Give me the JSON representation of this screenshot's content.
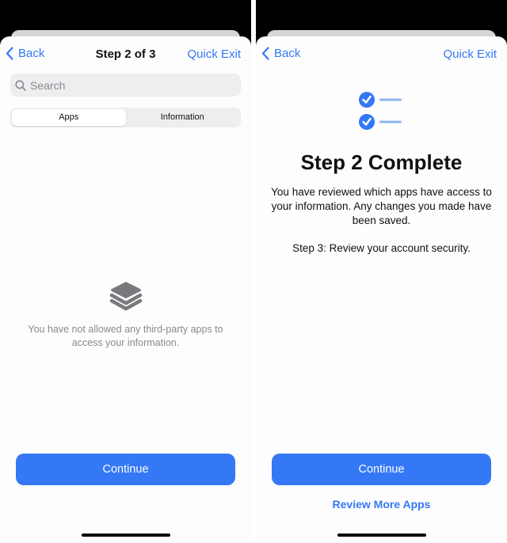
{
  "left_screen": {
    "nav": {
      "back_label": "Back",
      "title": "Step 2 of 3",
      "quick_exit_label": "Quick Exit"
    },
    "search": {
      "placeholder": "Search",
      "value": ""
    },
    "segments": [
      {
        "label": "Apps",
        "selected": true
      },
      {
        "label": "Information",
        "selected": false
      }
    ],
    "empty_state": {
      "icon": "stack-layers-icon",
      "message": "You have not allowed any third-party apps to access your information."
    },
    "continue_label": "Continue"
  },
  "right_screen": {
    "nav": {
      "back_label": "Back",
      "quick_exit_label": "Quick Exit"
    },
    "icon": "checklist-icon",
    "title": "Step 2 Complete",
    "body": "You have reviewed which apps have access to your information. Any changes you made have been saved.",
    "next_step": "Step 3: Review your account security.",
    "continue_label": "Continue",
    "review_more_label": "Review More Apps"
  },
  "colors": {
    "accent": "#3478f6",
    "check_line": "#8ab4f3",
    "muted_text": "#8a8a8e",
    "icon_gray": "#7a7a7e"
  }
}
